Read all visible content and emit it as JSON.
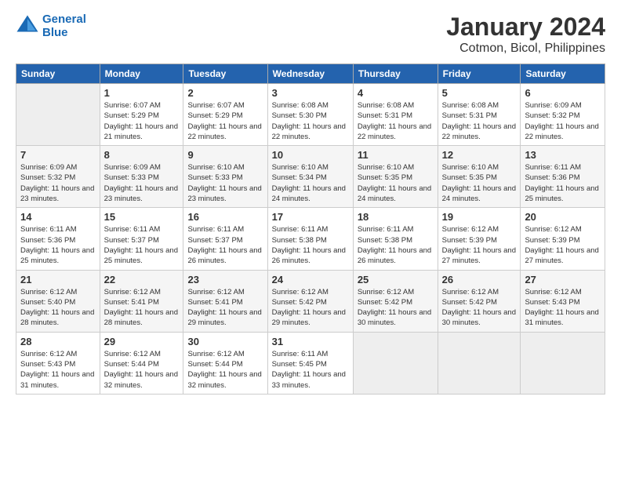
{
  "header": {
    "logo_line1": "General",
    "logo_line2": "Blue",
    "title": "January 2024",
    "subtitle": "Cotmon, Bicol, Philippines"
  },
  "days_of_week": [
    "Sunday",
    "Monday",
    "Tuesday",
    "Wednesday",
    "Thursday",
    "Friday",
    "Saturday"
  ],
  "weeks": [
    [
      {
        "date": "",
        "sunrise": "",
        "sunset": "",
        "daylight": ""
      },
      {
        "date": "1",
        "sunrise": "Sunrise: 6:07 AM",
        "sunset": "Sunset: 5:29 PM",
        "daylight": "Daylight: 11 hours and 21 minutes."
      },
      {
        "date": "2",
        "sunrise": "Sunrise: 6:07 AM",
        "sunset": "Sunset: 5:29 PM",
        "daylight": "Daylight: 11 hours and 22 minutes."
      },
      {
        "date": "3",
        "sunrise": "Sunrise: 6:08 AM",
        "sunset": "Sunset: 5:30 PM",
        "daylight": "Daylight: 11 hours and 22 minutes."
      },
      {
        "date": "4",
        "sunrise": "Sunrise: 6:08 AM",
        "sunset": "Sunset: 5:31 PM",
        "daylight": "Daylight: 11 hours and 22 minutes."
      },
      {
        "date": "5",
        "sunrise": "Sunrise: 6:08 AM",
        "sunset": "Sunset: 5:31 PM",
        "daylight": "Daylight: 11 hours and 22 minutes."
      },
      {
        "date": "6",
        "sunrise": "Sunrise: 6:09 AM",
        "sunset": "Sunset: 5:32 PM",
        "daylight": "Daylight: 11 hours and 22 minutes."
      }
    ],
    [
      {
        "date": "7",
        "sunrise": "Sunrise: 6:09 AM",
        "sunset": "Sunset: 5:32 PM",
        "daylight": "Daylight: 11 hours and 23 minutes."
      },
      {
        "date": "8",
        "sunrise": "Sunrise: 6:09 AM",
        "sunset": "Sunset: 5:33 PM",
        "daylight": "Daylight: 11 hours and 23 minutes."
      },
      {
        "date": "9",
        "sunrise": "Sunrise: 6:10 AM",
        "sunset": "Sunset: 5:33 PM",
        "daylight": "Daylight: 11 hours and 23 minutes."
      },
      {
        "date": "10",
        "sunrise": "Sunrise: 6:10 AM",
        "sunset": "Sunset: 5:34 PM",
        "daylight": "Daylight: 11 hours and 24 minutes."
      },
      {
        "date": "11",
        "sunrise": "Sunrise: 6:10 AM",
        "sunset": "Sunset: 5:35 PM",
        "daylight": "Daylight: 11 hours and 24 minutes."
      },
      {
        "date": "12",
        "sunrise": "Sunrise: 6:10 AM",
        "sunset": "Sunset: 5:35 PM",
        "daylight": "Daylight: 11 hours and 24 minutes."
      },
      {
        "date": "13",
        "sunrise": "Sunrise: 6:11 AM",
        "sunset": "Sunset: 5:36 PM",
        "daylight": "Daylight: 11 hours and 25 minutes."
      }
    ],
    [
      {
        "date": "14",
        "sunrise": "Sunrise: 6:11 AM",
        "sunset": "Sunset: 5:36 PM",
        "daylight": "Daylight: 11 hours and 25 minutes."
      },
      {
        "date": "15",
        "sunrise": "Sunrise: 6:11 AM",
        "sunset": "Sunset: 5:37 PM",
        "daylight": "Daylight: 11 hours and 25 minutes."
      },
      {
        "date": "16",
        "sunrise": "Sunrise: 6:11 AM",
        "sunset": "Sunset: 5:37 PM",
        "daylight": "Daylight: 11 hours and 26 minutes."
      },
      {
        "date": "17",
        "sunrise": "Sunrise: 6:11 AM",
        "sunset": "Sunset: 5:38 PM",
        "daylight": "Daylight: 11 hours and 26 minutes."
      },
      {
        "date": "18",
        "sunrise": "Sunrise: 6:11 AM",
        "sunset": "Sunset: 5:38 PM",
        "daylight": "Daylight: 11 hours and 26 minutes."
      },
      {
        "date": "19",
        "sunrise": "Sunrise: 6:12 AM",
        "sunset": "Sunset: 5:39 PM",
        "daylight": "Daylight: 11 hours and 27 minutes."
      },
      {
        "date": "20",
        "sunrise": "Sunrise: 6:12 AM",
        "sunset": "Sunset: 5:39 PM",
        "daylight": "Daylight: 11 hours and 27 minutes."
      }
    ],
    [
      {
        "date": "21",
        "sunrise": "Sunrise: 6:12 AM",
        "sunset": "Sunset: 5:40 PM",
        "daylight": "Daylight: 11 hours and 28 minutes."
      },
      {
        "date": "22",
        "sunrise": "Sunrise: 6:12 AM",
        "sunset": "Sunset: 5:41 PM",
        "daylight": "Daylight: 11 hours and 28 minutes."
      },
      {
        "date": "23",
        "sunrise": "Sunrise: 6:12 AM",
        "sunset": "Sunset: 5:41 PM",
        "daylight": "Daylight: 11 hours and 29 minutes."
      },
      {
        "date": "24",
        "sunrise": "Sunrise: 6:12 AM",
        "sunset": "Sunset: 5:42 PM",
        "daylight": "Daylight: 11 hours and 29 minutes."
      },
      {
        "date": "25",
        "sunrise": "Sunrise: 6:12 AM",
        "sunset": "Sunset: 5:42 PM",
        "daylight": "Daylight: 11 hours and 30 minutes."
      },
      {
        "date": "26",
        "sunrise": "Sunrise: 6:12 AM",
        "sunset": "Sunset: 5:42 PM",
        "daylight": "Daylight: 11 hours and 30 minutes."
      },
      {
        "date": "27",
        "sunrise": "Sunrise: 6:12 AM",
        "sunset": "Sunset: 5:43 PM",
        "daylight": "Daylight: 11 hours and 31 minutes."
      }
    ],
    [
      {
        "date": "28",
        "sunrise": "Sunrise: 6:12 AM",
        "sunset": "Sunset: 5:43 PM",
        "daylight": "Daylight: 11 hours and 31 minutes."
      },
      {
        "date": "29",
        "sunrise": "Sunrise: 6:12 AM",
        "sunset": "Sunset: 5:44 PM",
        "daylight": "Daylight: 11 hours and 32 minutes."
      },
      {
        "date": "30",
        "sunrise": "Sunrise: 6:12 AM",
        "sunset": "Sunset: 5:44 PM",
        "daylight": "Daylight: 11 hours and 32 minutes."
      },
      {
        "date": "31",
        "sunrise": "Sunrise: 6:11 AM",
        "sunset": "Sunset: 5:45 PM",
        "daylight": "Daylight: 11 hours and 33 minutes."
      },
      {
        "date": "",
        "sunrise": "",
        "sunset": "",
        "daylight": ""
      },
      {
        "date": "",
        "sunrise": "",
        "sunset": "",
        "daylight": ""
      },
      {
        "date": "",
        "sunrise": "",
        "sunset": "",
        "daylight": ""
      }
    ]
  ]
}
